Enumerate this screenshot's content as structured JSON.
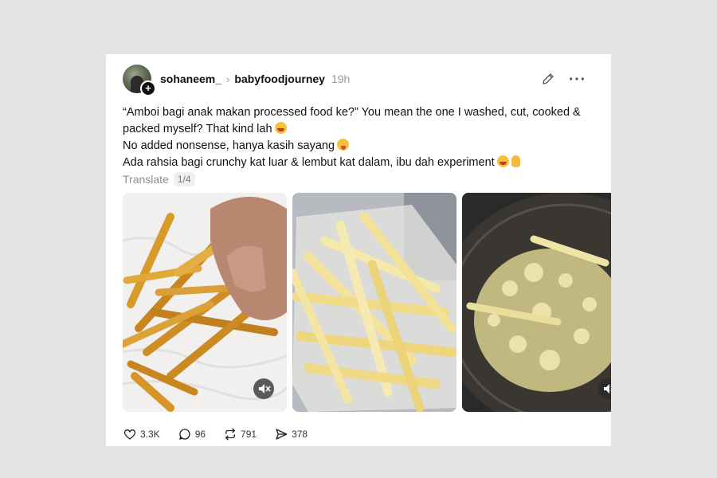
{
  "post": {
    "username": "sohaneem_",
    "community": "babyfoodjourney",
    "time": "19h",
    "lines": [
      "“Amboi bagi anak makan processed food ke?” You mean the one I washed, cut, cooked & packed myself? That kind lah",
      "No added nonsense, hanya kasih sayang",
      "Ada rahsia bagi crunchy kat luar & lembut kat dalam, ibu dah experiment"
    ],
    "translate_label": "Translate",
    "page_indicator": "1/4"
  },
  "icons": {
    "edit": "pencil-icon",
    "more": "more-horizontal-icon",
    "avatar_badge": "plus-icon",
    "mute": "speaker-muted-icon",
    "like": "heart-icon",
    "comment": "comment-icon",
    "repost": "repost-icon",
    "share": "send-icon"
  },
  "media": [
    {
      "description": "golden fries on paper towel",
      "muted": true
    },
    {
      "description": "raw cut potato sticks in container",
      "muted": false
    },
    {
      "description": "fries frying in oil",
      "muted": true
    }
  ],
  "actions": {
    "likes": "3.3K",
    "comments": "96",
    "reposts": "791",
    "shares": "378"
  },
  "colors": {
    "background": "#e4e4e4",
    "card": "#ffffff",
    "muted_text": "#999999"
  }
}
